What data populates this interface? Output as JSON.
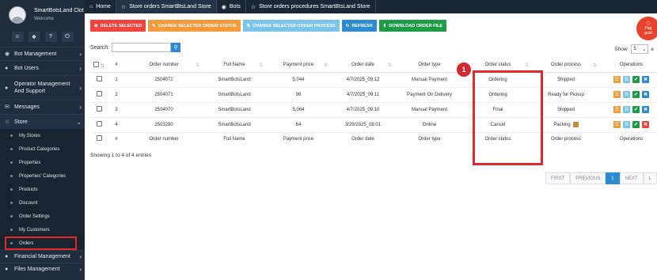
{
  "sidebar": {
    "user_name": "SmartBotsLand Clot",
    "welcome": "Welcome",
    "menu": [
      {
        "label": "Bot Management"
      },
      {
        "label": "Bot Users"
      },
      {
        "label": "Operator Management And Support"
      },
      {
        "label": "Messages"
      },
      {
        "label": "Store"
      }
    ],
    "store_items": [
      {
        "label": "My Stores"
      },
      {
        "label": "Product Categories"
      },
      {
        "label": "Properties"
      },
      {
        "label": "Properties' Categories"
      },
      {
        "label": "Products"
      },
      {
        "label": "Discount"
      },
      {
        "label": "Order Settings"
      },
      {
        "label": "My Customers"
      },
      {
        "label": "Orders"
      }
    ],
    "menu_after": [
      {
        "label": "Financial Management"
      },
      {
        "label": "Files Management"
      }
    ]
  },
  "tabs": [
    {
      "label": "Home"
    },
    {
      "label": "Store orders SmartBtsLand Store"
    },
    {
      "label": "Bots"
    },
    {
      "label": "Store orders procedures SmartBtsLand Store"
    }
  ],
  "toolbar": {
    "delete": "DELETE SELECTED",
    "change_status": "CHANGE SELECTED ORDER STATUS",
    "change_process": "CHANGE SELECTED ORDER PROCESS",
    "refresh": "REFRESH",
    "download": "DOWNLOAD ORDER FILE",
    "delete_color": "#f0453c",
    "status_color": "#f39a3a",
    "process_color": "#7cc5ea",
    "refresh_color": "#2d8bd0",
    "download_color": "#1e9b48"
  },
  "search": {
    "label": "Search:",
    "placeholder": ""
  },
  "show": {
    "label": "Show:",
    "value": "5",
    "suffix": "e"
  },
  "help_badge": {
    "line1": "Pag",
    "line2": "guid"
  },
  "table": {
    "headers": [
      "#",
      "Order number",
      "Full Name",
      "Payment price",
      "Order date",
      "Order type",
      "Order status",
      "Order process",
      "Operations"
    ],
    "rows": [
      {
        "n": "1",
        "order": "2504072",
        "name": "SmartBotsLand",
        "price": "5,044",
        "date": "4/7/2025_09:12",
        "type": "Manual Payment",
        "status": "Ordering",
        "process": "Shipped"
      },
      {
        "n": "2",
        "order": "2504071",
        "name": "SmartBotsLand",
        "price": "98",
        "date": "4/7/2025_09:11",
        "type": "Payment On Delivery",
        "status": "Ordering",
        "process": "Ready for Pickup"
      },
      {
        "n": "3",
        "order": "2504070",
        "name": "SmartBotsLand",
        "price": "5,064",
        "date": "4/7/2025_09:10",
        "type": "Manual Payment",
        "status": "Final",
        "process": "Shipped"
      },
      {
        "n": "4",
        "order": "2503290",
        "name": "SmartBotsLand",
        "price": "64",
        "date": "3/29/2025_08:01",
        "type": "Online",
        "status": "Cancel",
        "process": "Packing"
      }
    ],
    "footer": [
      "#",
      "Order number",
      "Full Name",
      "Payment price",
      "Order date",
      "Order type",
      "Order status",
      "Order process",
      "Operations"
    ],
    "ops_colors": [
      "#f39a3a",
      "#7cc5ea",
      "#1e9b48",
      "#2d8bd0"
    ],
    "row4_ops_colors": [
      "#f39a3a",
      "#7cc5ea",
      "#1e9b48",
      "#f0453c"
    ]
  },
  "annotation_number": "1",
  "info": "Showing 1 to 4 of 4 entries",
  "pager": [
    "FIRST",
    "PREVIOUS",
    "1",
    "NEXT",
    "L"
  ]
}
